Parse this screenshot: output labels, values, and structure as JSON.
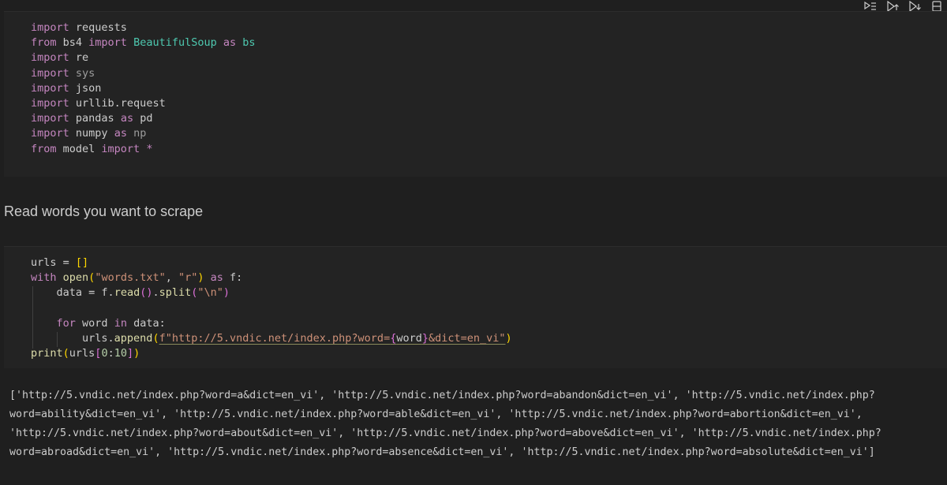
{
  "toolbar": {
    "icons": [
      "run-by-line-icon",
      "execute-above-icon",
      "execute-below-icon",
      "split-cell-icon"
    ]
  },
  "cell1": {
    "lines": [
      [
        {
          "t": "import",
          "c": "kw"
        },
        {
          "t": " requests",
          "c": "mod"
        }
      ],
      [
        {
          "t": "from",
          "c": "kw"
        },
        {
          "t": " bs4 ",
          "c": "mod"
        },
        {
          "t": "import",
          "c": "kw"
        },
        {
          "t": " ",
          "c": "mod"
        },
        {
          "t": "BeautifulSoup",
          "c": "cls"
        },
        {
          "t": " ",
          "c": "mod"
        },
        {
          "t": "as",
          "c": "as-kw"
        },
        {
          "t": " ",
          "c": "mod"
        },
        {
          "t": "bs",
          "c": "cls"
        }
      ],
      [
        {
          "t": "import",
          "c": "kw"
        },
        {
          "t": " re",
          "c": "mod"
        }
      ],
      [
        {
          "t": "import",
          "c": "kw"
        },
        {
          "t": " sys",
          "c": "dim"
        }
      ],
      [
        {
          "t": "import",
          "c": "kw"
        },
        {
          "t": " json",
          "c": "mod"
        }
      ],
      [
        {
          "t": "import",
          "c": "kw"
        },
        {
          "t": " urllib.request",
          "c": "mod"
        }
      ],
      [
        {
          "t": "import",
          "c": "kw"
        },
        {
          "t": " pandas ",
          "c": "mod"
        },
        {
          "t": "as",
          "c": "as-kw"
        },
        {
          "t": " pd",
          "c": "mod"
        }
      ],
      [
        {
          "t": "import",
          "c": "kw"
        },
        {
          "t": " numpy ",
          "c": "mod"
        },
        {
          "t": "as",
          "c": "as-kw"
        },
        {
          "t": " np",
          "c": "dim"
        }
      ],
      [
        {
          "t": "from",
          "c": "kw"
        },
        {
          "t": " model ",
          "c": "mod"
        },
        {
          "t": "import",
          "c": "kw"
        },
        {
          "t": " *",
          "c": "kw"
        }
      ]
    ]
  },
  "markdown": {
    "text": "Read words you want to scrape"
  },
  "cell2": {
    "lines": [
      [
        {
          "t": "urls",
          "c": "var"
        },
        {
          "t": " = ",
          "c": "op"
        },
        {
          "t": "[]",
          "c": "br1"
        }
      ],
      [
        {
          "t": "with",
          "c": "ctl"
        },
        {
          "t": " ",
          "c": "var"
        },
        {
          "t": "open",
          "c": "fn"
        },
        {
          "t": "(",
          "c": "br1"
        },
        {
          "t": "\"words.txt\"",
          "c": "str"
        },
        {
          "t": ", ",
          "c": "var"
        },
        {
          "t": "\"r\"",
          "c": "str"
        },
        {
          "t": ")",
          "c": "br1"
        },
        {
          "t": " ",
          "c": "var"
        },
        {
          "t": "as",
          "c": "ctl"
        },
        {
          "t": " f:",
          "c": "var"
        }
      ],
      [
        {
          "t": "    data",
          "c": "var"
        },
        {
          "t": " = ",
          "c": "op"
        },
        {
          "t": "f.",
          "c": "var"
        },
        {
          "t": "read",
          "c": "fn"
        },
        {
          "t": "()",
          "c": "br2"
        },
        {
          "t": ".",
          "c": "var"
        },
        {
          "t": "split",
          "c": "fn"
        },
        {
          "t": "(",
          "c": "br2"
        },
        {
          "t": "\"\\n\"",
          "c": "str"
        },
        {
          "t": ")",
          "c": "br2"
        }
      ],
      [
        {
          "t": "",
          "c": "var"
        }
      ],
      [
        {
          "t": "    ",
          "c": "var"
        },
        {
          "t": "for",
          "c": "ctl"
        },
        {
          "t": " word ",
          "c": "var"
        },
        {
          "t": "in",
          "c": "ctl"
        },
        {
          "t": " data:",
          "c": "var"
        }
      ],
      [
        {
          "t": "        urls.",
          "c": "var"
        },
        {
          "t": "append",
          "c": "fn"
        },
        {
          "t": "(",
          "c": "br1"
        },
        {
          "t": "f\"http://5.vndic.net/index.php?word=",
          "c": "fstr uline"
        },
        {
          "t": "{",
          "c": "br2 uline"
        },
        {
          "t": "word",
          "c": "fexpr uline"
        },
        {
          "t": "}",
          "c": "br2 uline"
        },
        {
          "t": "&dict=en_vi\"",
          "c": "fstr uline"
        },
        {
          "t": ")",
          "c": "br1"
        }
      ],
      [
        {
          "t": "print",
          "c": "fn"
        },
        {
          "t": "(",
          "c": "br1"
        },
        {
          "t": "urls",
          "c": "var"
        },
        {
          "t": "[",
          "c": "br2"
        },
        {
          "t": "0",
          "c": "num"
        },
        {
          "t": ":",
          "c": "var"
        },
        {
          "t": "10",
          "c": "num"
        },
        {
          "t": "]",
          "c": "br2"
        },
        {
          "t": ")",
          "c": "br1"
        }
      ]
    ]
  },
  "output": {
    "lines": [
      "['http://5.vndic.net/index.php?word=a&dict=en_vi', 'http://5.vndic.net/index.php?word=abandon&dict=en_vi', 'http://5.vndic.net/index.php?",
      "word=ability&dict=en_vi', 'http://5.vndic.net/index.php?word=able&dict=en_vi', 'http://5.vndic.net/index.php?word=abortion&dict=en_vi',",
      "'http://5.vndic.net/index.php?word=about&dict=en_vi', 'http://5.vndic.net/index.php?word=above&dict=en_vi', 'http://5.vndic.net/index.php?",
      "word=abroad&dict=en_vi', 'http://5.vndic.net/index.php?word=absence&dict=en_vi', 'http://5.vndic.net/index.php?word=absolute&dict=en_vi']"
    ]
  }
}
